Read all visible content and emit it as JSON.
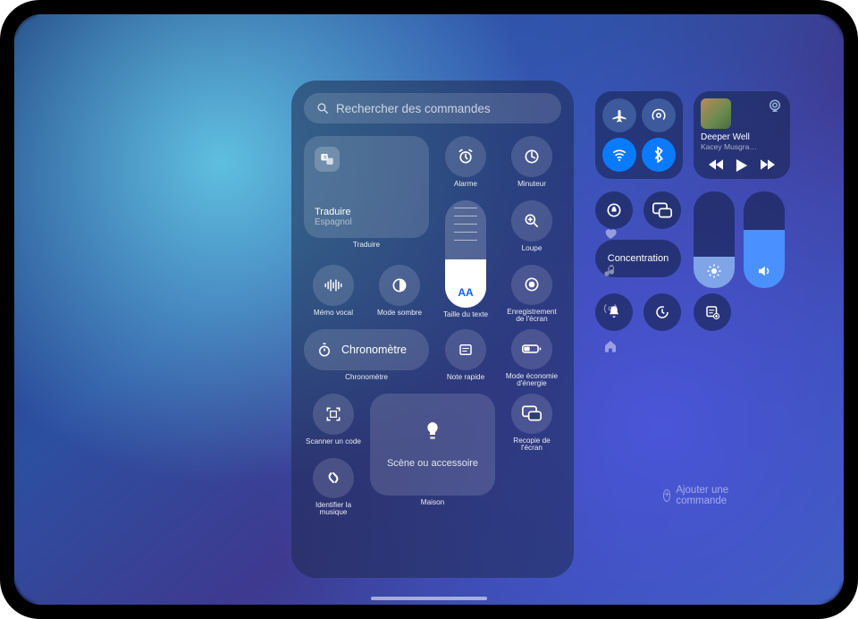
{
  "search": {
    "placeholder": "Rechercher des commandes"
  },
  "gallery": {
    "translate": {
      "title": "Traduire",
      "language": "Espagnol",
      "label": "Traduire"
    },
    "alarm": "Alarme",
    "timer": "Minuteur",
    "magnifier": "Loupe",
    "voice_memo": "Mémo vocal",
    "dark_mode": "Mode sombre",
    "text_size": {
      "label": "Taille du texte",
      "glyph": "AA"
    },
    "screen_rec": "Enregistrement de l'écran",
    "stopwatch": {
      "inner": "Chronomètre",
      "label": "Chronomètre"
    },
    "quick_note": "Note rapide",
    "low_power": "Mode économie d'énergie",
    "scan_code": "Scanner un code",
    "home": {
      "scene": "Scène ou accessoire",
      "label": "Maison"
    },
    "screen_mirror": "Recopie de l'écran",
    "shazam": "Identifier la musique"
  },
  "cc": {
    "focus": "Concentration",
    "now_playing": {
      "title": "Deeper Well",
      "artist": "Kacey Musgra…"
    },
    "add_command": "Ajouter une commande"
  }
}
